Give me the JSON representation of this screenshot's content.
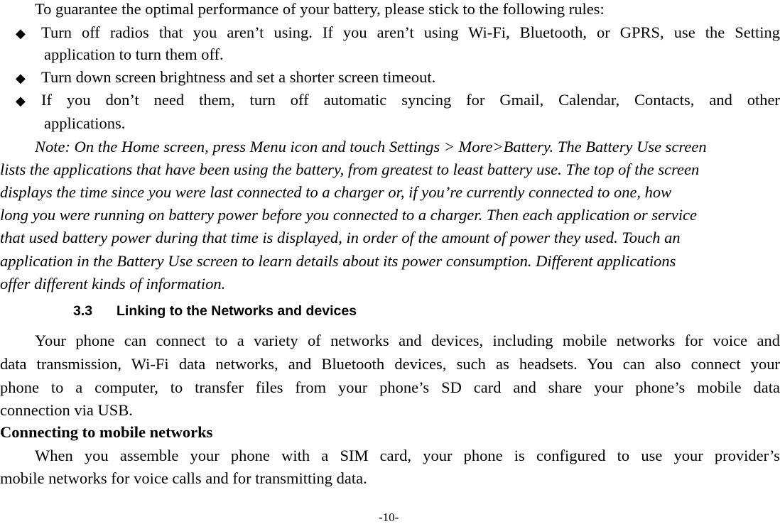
{
  "intro": "To guarantee the optimal performance of your battery, please stick to the following rules:",
  "bullets": [
    {
      "line1": "Turn off radios that you aren’t using. If you aren’t using Wi-Fi, Bluetooth, or GPRS, use the Setting",
      "line2": "application to turn them off."
    },
    {
      "line1": "Turn down screen brightness and set a shorter screen timeout."
    },
    {
      "line1": "If you don’t need them, turn off automatic syncing for Gmail, Calendar, Contacts, and other",
      "line2": "applications."
    }
  ],
  "bullet_glyph": "◆",
  "note_lines": [
    "Note: On the Home screen, press Menu icon and touch Settings > More>Battery. The Battery Use screen",
    "lists the applications that have been using the battery, from greatest to least battery use. The top of the screen",
    "displays the time since you were last connected to a charger or, if you’re currently connected to one, how",
    "long you were running on battery power before you connected to a charger. Then each application or service",
    "that used battery power during that time is displayed, in order of the amount of power they used. Touch an",
    "application in the Battery Use screen to learn details about its power consumption. Different applications",
    "offer different kinds of information."
  ],
  "section": {
    "number": "3.3",
    "title": "Linking to the Networks and devices"
  },
  "section_paragraph": [
    "Your phone can connect to a variety of networks and devices, including mobile networks for voice and",
    "data transmission, Wi-Fi data networks, and Bluetooth devices, such as headsets. You can also connect your",
    "phone to a computer, to transfer files from your phone’s SD card and share your phone’s mobile data",
    "connection via USB."
  ],
  "subheading": "Connecting to mobile networks",
  "mobile_paragraph": [
    "When you assemble your phone with a SIM card, your phone is configured to use your provider’s",
    "mobile networks for voice calls and for transmitting data."
  ],
  "page_number": "-10-"
}
